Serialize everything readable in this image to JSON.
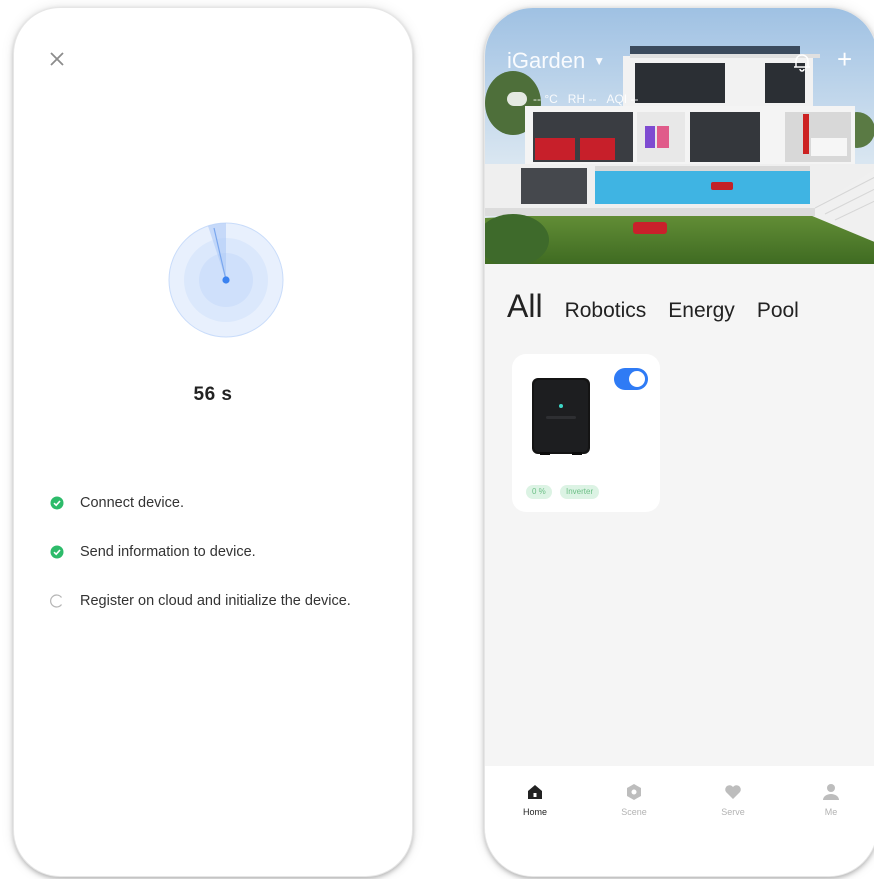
{
  "connect_screen": {
    "close_icon": "close-icon",
    "timer": "56 s",
    "steps": [
      {
        "label": "Connect device.",
        "status": "done"
      },
      {
        "label": "Send information to device.",
        "status": "done"
      },
      {
        "label": "Register on cloud and initialize the device.",
        "status": "loading"
      }
    ],
    "colors": {
      "done": "#2dbb6a",
      "radar": "#4b8ff0"
    }
  },
  "home_screen": {
    "home_name": "iGarden",
    "env": {
      "temp": "-- °C",
      "rh": "RH --",
      "aqi": "AQI --"
    },
    "tabs": [
      "All",
      "Robotics",
      "Energy",
      "Pool"
    ],
    "active_tab": "All",
    "devices": [
      {
        "toggle_on": true,
        "tags": [
          "0 %",
          "Inverter"
        ]
      }
    ],
    "bottom_nav": [
      {
        "label": "Home",
        "icon": "home-icon",
        "active": true
      },
      {
        "label": "Scene",
        "icon": "scene-icon",
        "active": false
      },
      {
        "label": "Serve",
        "icon": "heart-icon",
        "active": false
      },
      {
        "label": "Me",
        "icon": "person-icon",
        "active": false
      }
    ],
    "colors": {
      "toggle": "#2f7bf5"
    }
  }
}
